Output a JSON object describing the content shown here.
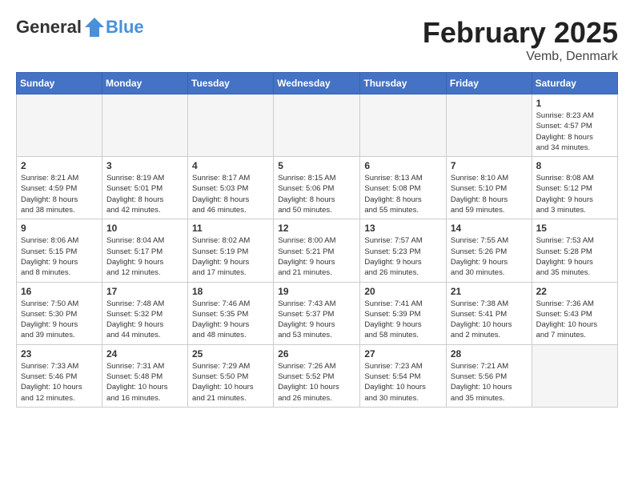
{
  "header": {
    "logo_general": "General",
    "logo_blue": "Blue",
    "month_year": "February 2025",
    "location": "Vemb, Denmark"
  },
  "days_of_week": [
    "Sunday",
    "Monday",
    "Tuesday",
    "Wednesday",
    "Thursday",
    "Friday",
    "Saturday"
  ],
  "weeks": [
    [
      {
        "num": "",
        "info": "",
        "empty": true
      },
      {
        "num": "",
        "info": "",
        "empty": true
      },
      {
        "num": "",
        "info": "",
        "empty": true
      },
      {
        "num": "",
        "info": "",
        "empty": true
      },
      {
        "num": "",
        "info": "",
        "empty": true
      },
      {
        "num": "",
        "info": "",
        "empty": true
      },
      {
        "num": "1",
        "info": "Sunrise: 8:23 AM\nSunset: 4:57 PM\nDaylight: 8 hours\nand 34 minutes.",
        "empty": false
      }
    ],
    [
      {
        "num": "2",
        "info": "Sunrise: 8:21 AM\nSunset: 4:59 PM\nDaylight: 8 hours\nand 38 minutes.",
        "empty": false
      },
      {
        "num": "3",
        "info": "Sunrise: 8:19 AM\nSunset: 5:01 PM\nDaylight: 8 hours\nand 42 minutes.",
        "empty": false
      },
      {
        "num": "4",
        "info": "Sunrise: 8:17 AM\nSunset: 5:03 PM\nDaylight: 8 hours\nand 46 minutes.",
        "empty": false
      },
      {
        "num": "5",
        "info": "Sunrise: 8:15 AM\nSunset: 5:06 PM\nDaylight: 8 hours\nand 50 minutes.",
        "empty": false
      },
      {
        "num": "6",
        "info": "Sunrise: 8:13 AM\nSunset: 5:08 PM\nDaylight: 8 hours\nand 55 minutes.",
        "empty": false
      },
      {
        "num": "7",
        "info": "Sunrise: 8:10 AM\nSunset: 5:10 PM\nDaylight: 8 hours\nand 59 minutes.",
        "empty": false
      },
      {
        "num": "8",
        "info": "Sunrise: 8:08 AM\nSunset: 5:12 PM\nDaylight: 9 hours\nand 3 minutes.",
        "empty": false
      }
    ],
    [
      {
        "num": "9",
        "info": "Sunrise: 8:06 AM\nSunset: 5:15 PM\nDaylight: 9 hours\nand 8 minutes.",
        "empty": false
      },
      {
        "num": "10",
        "info": "Sunrise: 8:04 AM\nSunset: 5:17 PM\nDaylight: 9 hours\nand 12 minutes.",
        "empty": false
      },
      {
        "num": "11",
        "info": "Sunrise: 8:02 AM\nSunset: 5:19 PM\nDaylight: 9 hours\nand 17 minutes.",
        "empty": false
      },
      {
        "num": "12",
        "info": "Sunrise: 8:00 AM\nSunset: 5:21 PM\nDaylight: 9 hours\nand 21 minutes.",
        "empty": false
      },
      {
        "num": "13",
        "info": "Sunrise: 7:57 AM\nSunset: 5:23 PM\nDaylight: 9 hours\nand 26 minutes.",
        "empty": false
      },
      {
        "num": "14",
        "info": "Sunrise: 7:55 AM\nSunset: 5:26 PM\nDaylight: 9 hours\nand 30 minutes.",
        "empty": false
      },
      {
        "num": "15",
        "info": "Sunrise: 7:53 AM\nSunset: 5:28 PM\nDaylight: 9 hours\nand 35 minutes.",
        "empty": false
      }
    ],
    [
      {
        "num": "16",
        "info": "Sunrise: 7:50 AM\nSunset: 5:30 PM\nDaylight: 9 hours\nand 39 minutes.",
        "empty": false
      },
      {
        "num": "17",
        "info": "Sunrise: 7:48 AM\nSunset: 5:32 PM\nDaylight: 9 hours\nand 44 minutes.",
        "empty": false
      },
      {
        "num": "18",
        "info": "Sunrise: 7:46 AM\nSunset: 5:35 PM\nDaylight: 9 hours\nand 48 minutes.",
        "empty": false
      },
      {
        "num": "19",
        "info": "Sunrise: 7:43 AM\nSunset: 5:37 PM\nDaylight: 9 hours\nand 53 minutes.",
        "empty": false
      },
      {
        "num": "20",
        "info": "Sunrise: 7:41 AM\nSunset: 5:39 PM\nDaylight: 9 hours\nand 58 minutes.",
        "empty": false
      },
      {
        "num": "21",
        "info": "Sunrise: 7:38 AM\nSunset: 5:41 PM\nDaylight: 10 hours\nand 2 minutes.",
        "empty": false
      },
      {
        "num": "22",
        "info": "Sunrise: 7:36 AM\nSunset: 5:43 PM\nDaylight: 10 hours\nand 7 minutes.",
        "empty": false
      }
    ],
    [
      {
        "num": "23",
        "info": "Sunrise: 7:33 AM\nSunset: 5:46 PM\nDaylight: 10 hours\nand 12 minutes.",
        "empty": false
      },
      {
        "num": "24",
        "info": "Sunrise: 7:31 AM\nSunset: 5:48 PM\nDaylight: 10 hours\nand 16 minutes.",
        "empty": false
      },
      {
        "num": "25",
        "info": "Sunrise: 7:29 AM\nSunset: 5:50 PM\nDaylight: 10 hours\nand 21 minutes.",
        "empty": false
      },
      {
        "num": "26",
        "info": "Sunrise: 7:26 AM\nSunset: 5:52 PM\nDaylight: 10 hours\nand 26 minutes.",
        "empty": false
      },
      {
        "num": "27",
        "info": "Sunrise: 7:23 AM\nSunset: 5:54 PM\nDaylight: 10 hours\nand 30 minutes.",
        "empty": false
      },
      {
        "num": "28",
        "info": "Sunrise: 7:21 AM\nSunset: 5:56 PM\nDaylight: 10 hours\nand 35 minutes.",
        "empty": false
      },
      {
        "num": "",
        "info": "",
        "empty": true
      }
    ]
  ]
}
